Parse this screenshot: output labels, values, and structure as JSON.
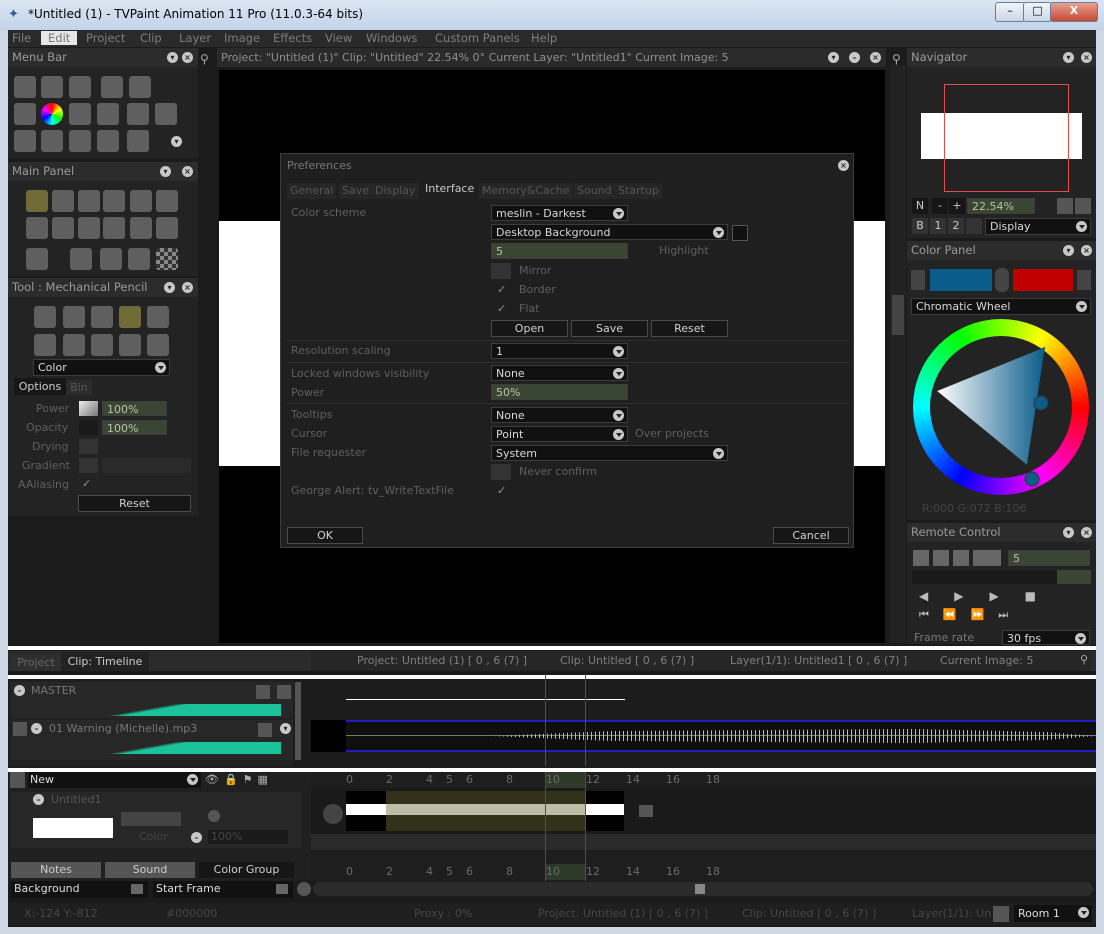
{
  "window": {
    "title": "*Untitled (1) - TVPaint Animation 11 Pro (11.0.3-64 bits)",
    "min": "–",
    "max": "□",
    "close": "X"
  },
  "menubar": [
    "File",
    "Edit",
    "Project",
    "Clip",
    "Layer",
    "Image",
    "Effects",
    "View",
    "Windows",
    "Custom Panels",
    "Help"
  ],
  "panels": {
    "menu_bar_title": "Menu Bar",
    "main_panel_title": "Main Panel",
    "tool_title": "Tool : Mechanical Pencil",
    "tool_mode": "Color",
    "tool_tabs": [
      "Options",
      "Bin"
    ],
    "power_label": "Power",
    "power_value": "100%",
    "opacity_label": "Opacity",
    "opacity_value": "100%",
    "drying_label": "Drying",
    "gradient_label": "Gradient",
    "aaliasing_label": "AAliasing",
    "reset": "Reset"
  },
  "viewport": {
    "info": "Project: \"Untitled (1)\"  Clip: \"Untitled\"   22.54%   0°   Current Layer: \"Untitled1\"   Current Image: 5"
  },
  "prefs": {
    "title": "Preferences",
    "tabs": [
      "General",
      "Save",
      "Display",
      "Interface",
      "Memory&Cache",
      "Sound",
      "Startup"
    ],
    "color_scheme_label": "Color scheme",
    "color_scheme": "meslin - Darkest",
    "background": "Desktop Background",
    "highlight_value": "5",
    "highlight_label": "Highlight",
    "mirror": "Mirror",
    "border": "Border",
    "flat": "Flat",
    "open": "Open",
    "save": "Save",
    "reset": "Reset",
    "res_label": "Resolution scaling",
    "res_value": "1",
    "locked_label": "Locked windows visibility",
    "locked_value": "None",
    "power_label": "Power",
    "power_value": "50%",
    "tooltips_label": "Tooltips",
    "tooltips_value": "None",
    "cursor_label": "Cursor",
    "cursor_value": "Point",
    "over_projects": "Over projects",
    "file_label": "File requester",
    "file_value": "System",
    "never_confirm": "Never confirm",
    "george_label": "George Alert: tv_WriteTextFile",
    "ok": "OK",
    "cancel": "Cancel"
  },
  "navigator": {
    "title": "Navigator",
    "zoom": "22.54%",
    "display": "Display",
    "b1": "N",
    "b2": "-",
    "b3": "+",
    "c1": "B",
    "c2": "1",
    "c3": "2"
  },
  "color_panel": {
    "title": "Color Panel",
    "mode": "Chromatic Wheel",
    "rgb": "R:000 G:072 B:106",
    "colorA": "#0a5c8a",
    "colorB": "#c00000"
  },
  "remote": {
    "title": "Remote Control",
    "frame_value": "5",
    "frame_rate_label": "Frame rate",
    "frame_rate": "30 fps"
  },
  "timeline": {
    "tabs": [
      "Project",
      "Clip: Timeline"
    ],
    "info_project": "Project: Untitled (1) [ 0 , 6  (7) ]",
    "info_clip": "Clip: Untitled [ 0 , 6  (7) ]",
    "info_layer": "Layer(1/1): Untitled1 [ 0 , 6  (7) ]",
    "info_image": "Current Image: 5",
    "master": "MASTER",
    "sound_track": "01 Warning (Michelle).mp3",
    "layer_group": "New",
    "layer_name": "Untitled1",
    "color_label": "Color",
    "opacity": "100%",
    "ruler": [
      "0",
      "2",
      "4",
      "5",
      "6",
      "8",
      "10",
      "12",
      "14",
      "16",
      "18"
    ],
    "bottom_tabs": [
      "Notes",
      "Sound",
      "Color Group"
    ],
    "background": "Background",
    "start_frame": "Start Frame"
  },
  "status": {
    "coords": "X:-124  Y:-812",
    "color": "#000000",
    "proxy": "Proxy : 0%",
    "project": "Project: Untitled (1) [ 0 , 6  (7) ]",
    "clip": "Clip: Untitled [ 0 , 6  (7) ]",
    "layer": "Layer(1/1): Un",
    "room": "Room 1"
  }
}
